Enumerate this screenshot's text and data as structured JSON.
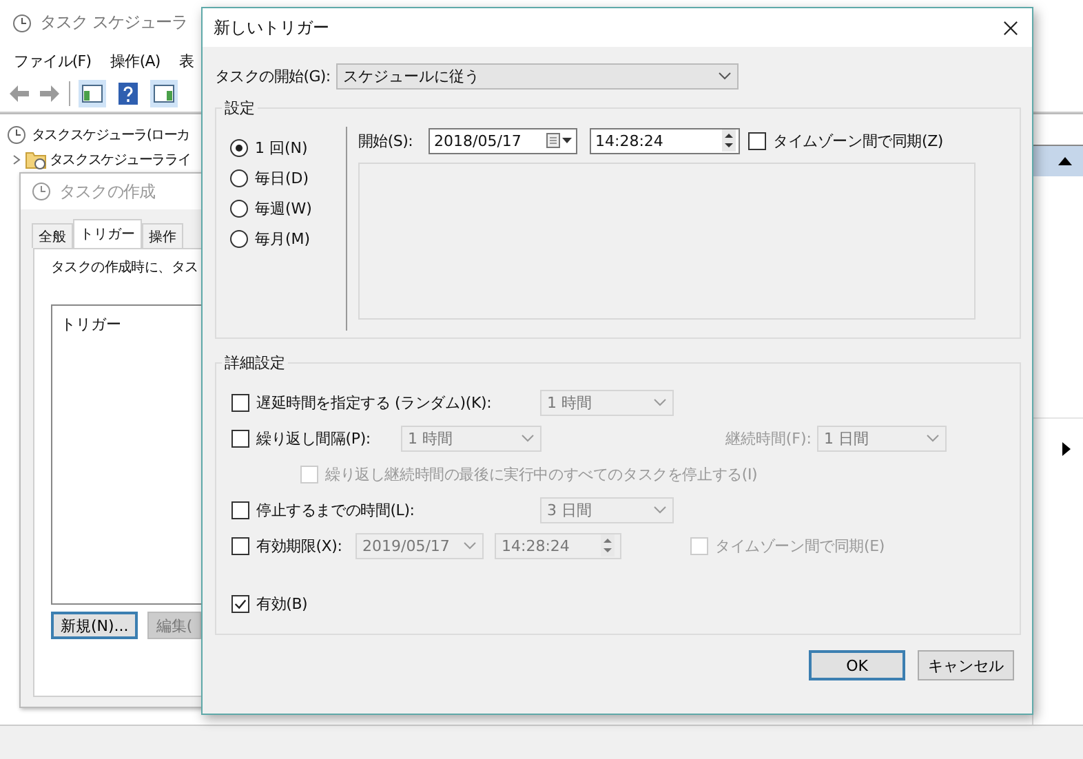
{
  "main_window": {
    "title": "タスク スケジューラ",
    "menu": [
      "ファイル(F)",
      "操作(A)",
      "表"
    ],
    "tree": [
      {
        "label": "タスク スケジューラ (ローカ",
        "children": [
          {
            "label": "タスク スケジューラ ライ",
            "expanded": false
          }
        ]
      }
    ]
  },
  "create_task_window": {
    "title": "タスクの作成",
    "tabs": [
      {
        "label": "全般",
        "selected": false
      },
      {
        "label": "トリガー",
        "selected": true
      },
      {
        "label": "操作",
        "selected": false
      }
    ],
    "description": "タスクの作成時に、タス",
    "list_header": "トリガー",
    "buttons": [
      {
        "label": "新規(N)...",
        "disabled": false
      },
      {
        "label": "編集(",
        "disabled": true
      }
    ]
  },
  "dialog": {
    "title": "新しいトリガー",
    "start_task": {
      "label": "タスクの開始(G):",
      "value": "スケジュールに従う"
    },
    "settings": {
      "legend": "設定",
      "schedules": [
        {
          "label": "1 回(N)",
          "selected": true
        },
        {
          "label": "毎日(D)",
          "selected": false
        },
        {
          "label": "毎週(W)",
          "selected": false
        },
        {
          "label": "毎月(M)",
          "selected": false
        }
      ],
      "start_label": "開始(S):",
      "date": "2018/05/17",
      "time": "14:28:24",
      "sync": {
        "label": "タイムゾーン間で同期(Z)",
        "checked": false
      }
    },
    "advanced": {
      "legend": "詳細設定",
      "delay": {
        "label": "遅延時間を指定する (ランダム)(K):",
        "checked": false,
        "value": "1 時間",
        "disabled": true
      },
      "repeat": {
        "label": "繰り返し間隔(P):",
        "checked": false,
        "value": "1 時間",
        "disabled": true,
        "duration_label": "継続時間(F):",
        "duration_value": "1 日間"
      },
      "stop_all": {
        "label": "繰り返し継続時間の最後に実行中のすべてのタスクを停止する(I)",
        "checked": false,
        "disabled": true
      },
      "stop_after": {
        "label": "停止するまでの時間(L):",
        "checked": false,
        "value": "3 日間",
        "disabled": true
      },
      "expire": {
        "label": "有効期限(X):",
        "checked": false,
        "date": "2019/05/17",
        "time": "14:28:24",
        "disabled": true,
        "sync_label": "タイムゾーン間で同期(E)",
        "sync_checked": false
      },
      "enabled": {
        "label": "有効(B)",
        "checked": true
      }
    },
    "buttons": [
      {
        "label": "OK",
        "default": true
      },
      {
        "label": "キャンセル",
        "default": false
      }
    ]
  }
}
